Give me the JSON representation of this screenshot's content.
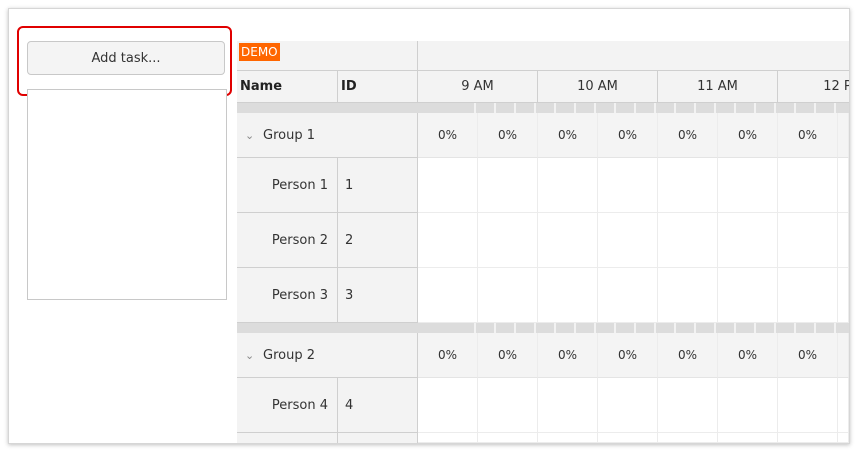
{
  "left_panel": {
    "add_button_label": "Add task..."
  },
  "scheduler": {
    "demo_badge": "DEMO",
    "columns": {
      "name": "Name",
      "id": "ID"
    },
    "hours": [
      "9 AM",
      "10 AM",
      "11 AM",
      "12 P"
    ],
    "groups": [
      {
        "name": "Group 1",
        "loads": [
          "0%",
          "0%",
          "0%",
          "0%",
          "0%",
          "0%",
          "0%"
        ],
        "people": [
          {
            "name": "Person 1",
            "id": "1"
          },
          {
            "name": "Person 2",
            "id": "2"
          },
          {
            "name": "Person 3",
            "id": "3"
          }
        ]
      },
      {
        "name": "Group 2",
        "loads": [
          "0%",
          "0%",
          "0%",
          "0%",
          "0%",
          "0%",
          "0%"
        ],
        "people": [
          {
            "name": "Person 4",
            "id": "4"
          }
        ]
      }
    ]
  },
  "colors": {
    "highlight": "#e00000",
    "demo_badge": "#ff6600"
  }
}
